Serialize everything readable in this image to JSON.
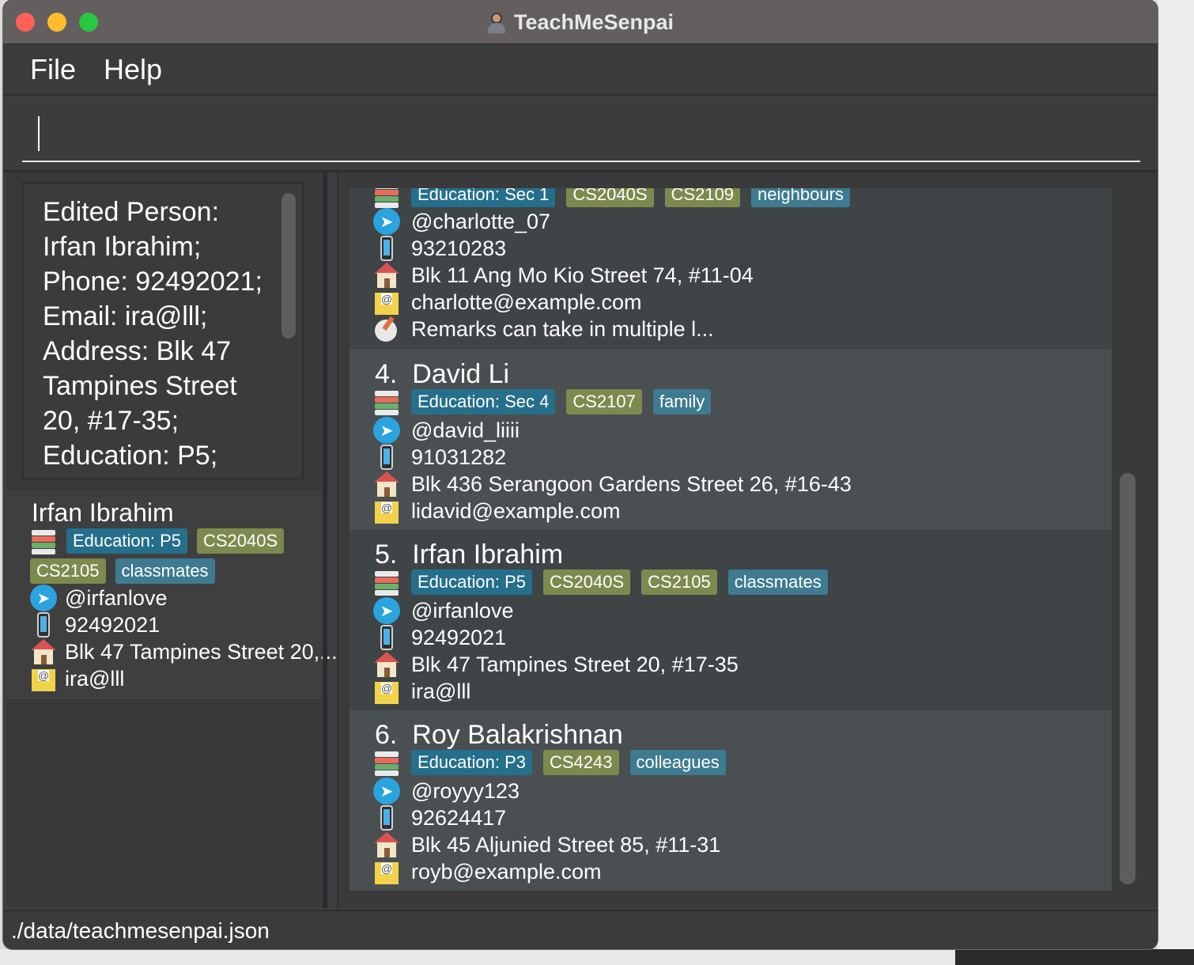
{
  "window": {
    "title": "TeachMeSenpai"
  },
  "menu": {
    "file": "File",
    "help": "Help"
  },
  "command": {
    "value": ""
  },
  "result": {
    "text": "Edited Person:\nIrfan Ibrahim;\nPhone: 92492021;\nEmail: ira@lll;\nAddress: Blk 47\nTampines Street\n20, #17-35;\nEducation: P5;"
  },
  "detail": {
    "name": "Irfan Ibrahim",
    "education": "Education: P5",
    "tags": [
      "CS2040S",
      "CS2105",
      "classmates"
    ],
    "telegram": "@irfanlove",
    "phone": "92492021",
    "address": "Blk 47 Tampines Street 20,...",
    "email": "ira@lll"
  },
  "persons": [
    {
      "index": "",
      "name": "",
      "education": "Education: Sec 1",
      "modules": [
        "CS2040S",
        "CS2109"
      ],
      "groups": [
        "neighbours"
      ],
      "telegram": "@charlotte_07",
      "phone": "93210283",
      "address": "Blk 11 Ang Mo Kio Street 74, #11-04",
      "email": "charlotte@example.com",
      "remark": "Remarks can take in multiple l..."
    },
    {
      "index": "4.",
      "name": "David Li",
      "education": "Education: Sec 4",
      "modules": [
        "CS2107"
      ],
      "groups": [
        "family"
      ],
      "telegram": "@david_liiii",
      "phone": "91031282",
      "address": "Blk 436 Serangoon Gardens Street 26, #16-43",
      "email": "lidavid@example.com"
    },
    {
      "index": "5.",
      "name": "Irfan Ibrahim",
      "education": "Education: P5",
      "modules": [
        "CS2040S",
        "CS2105"
      ],
      "groups": [
        "classmates"
      ],
      "telegram": "@irfanlove",
      "phone": "92492021",
      "address": "Blk 47 Tampines Street 20, #17-35",
      "email": "ira@lll"
    },
    {
      "index": "6.",
      "name": "Roy Balakrishnan",
      "education": "Education: P3",
      "modules": [
        "CS4243"
      ],
      "groups": [
        "colleagues"
      ],
      "telegram": "@royyy123",
      "phone": "92624417",
      "address": "Blk 45 Aljunied Street 85, #11-31",
      "email": "royb@example.com"
    }
  ],
  "status": {
    "path": "./data/teachmesenpai.json"
  },
  "colors": {
    "tag_education": "#256f8c",
    "tag_module": "#7d8a4e",
    "tag_group": "#3e7b91",
    "card_odd": "#3f4447",
    "card_even": "#4a4f52"
  }
}
